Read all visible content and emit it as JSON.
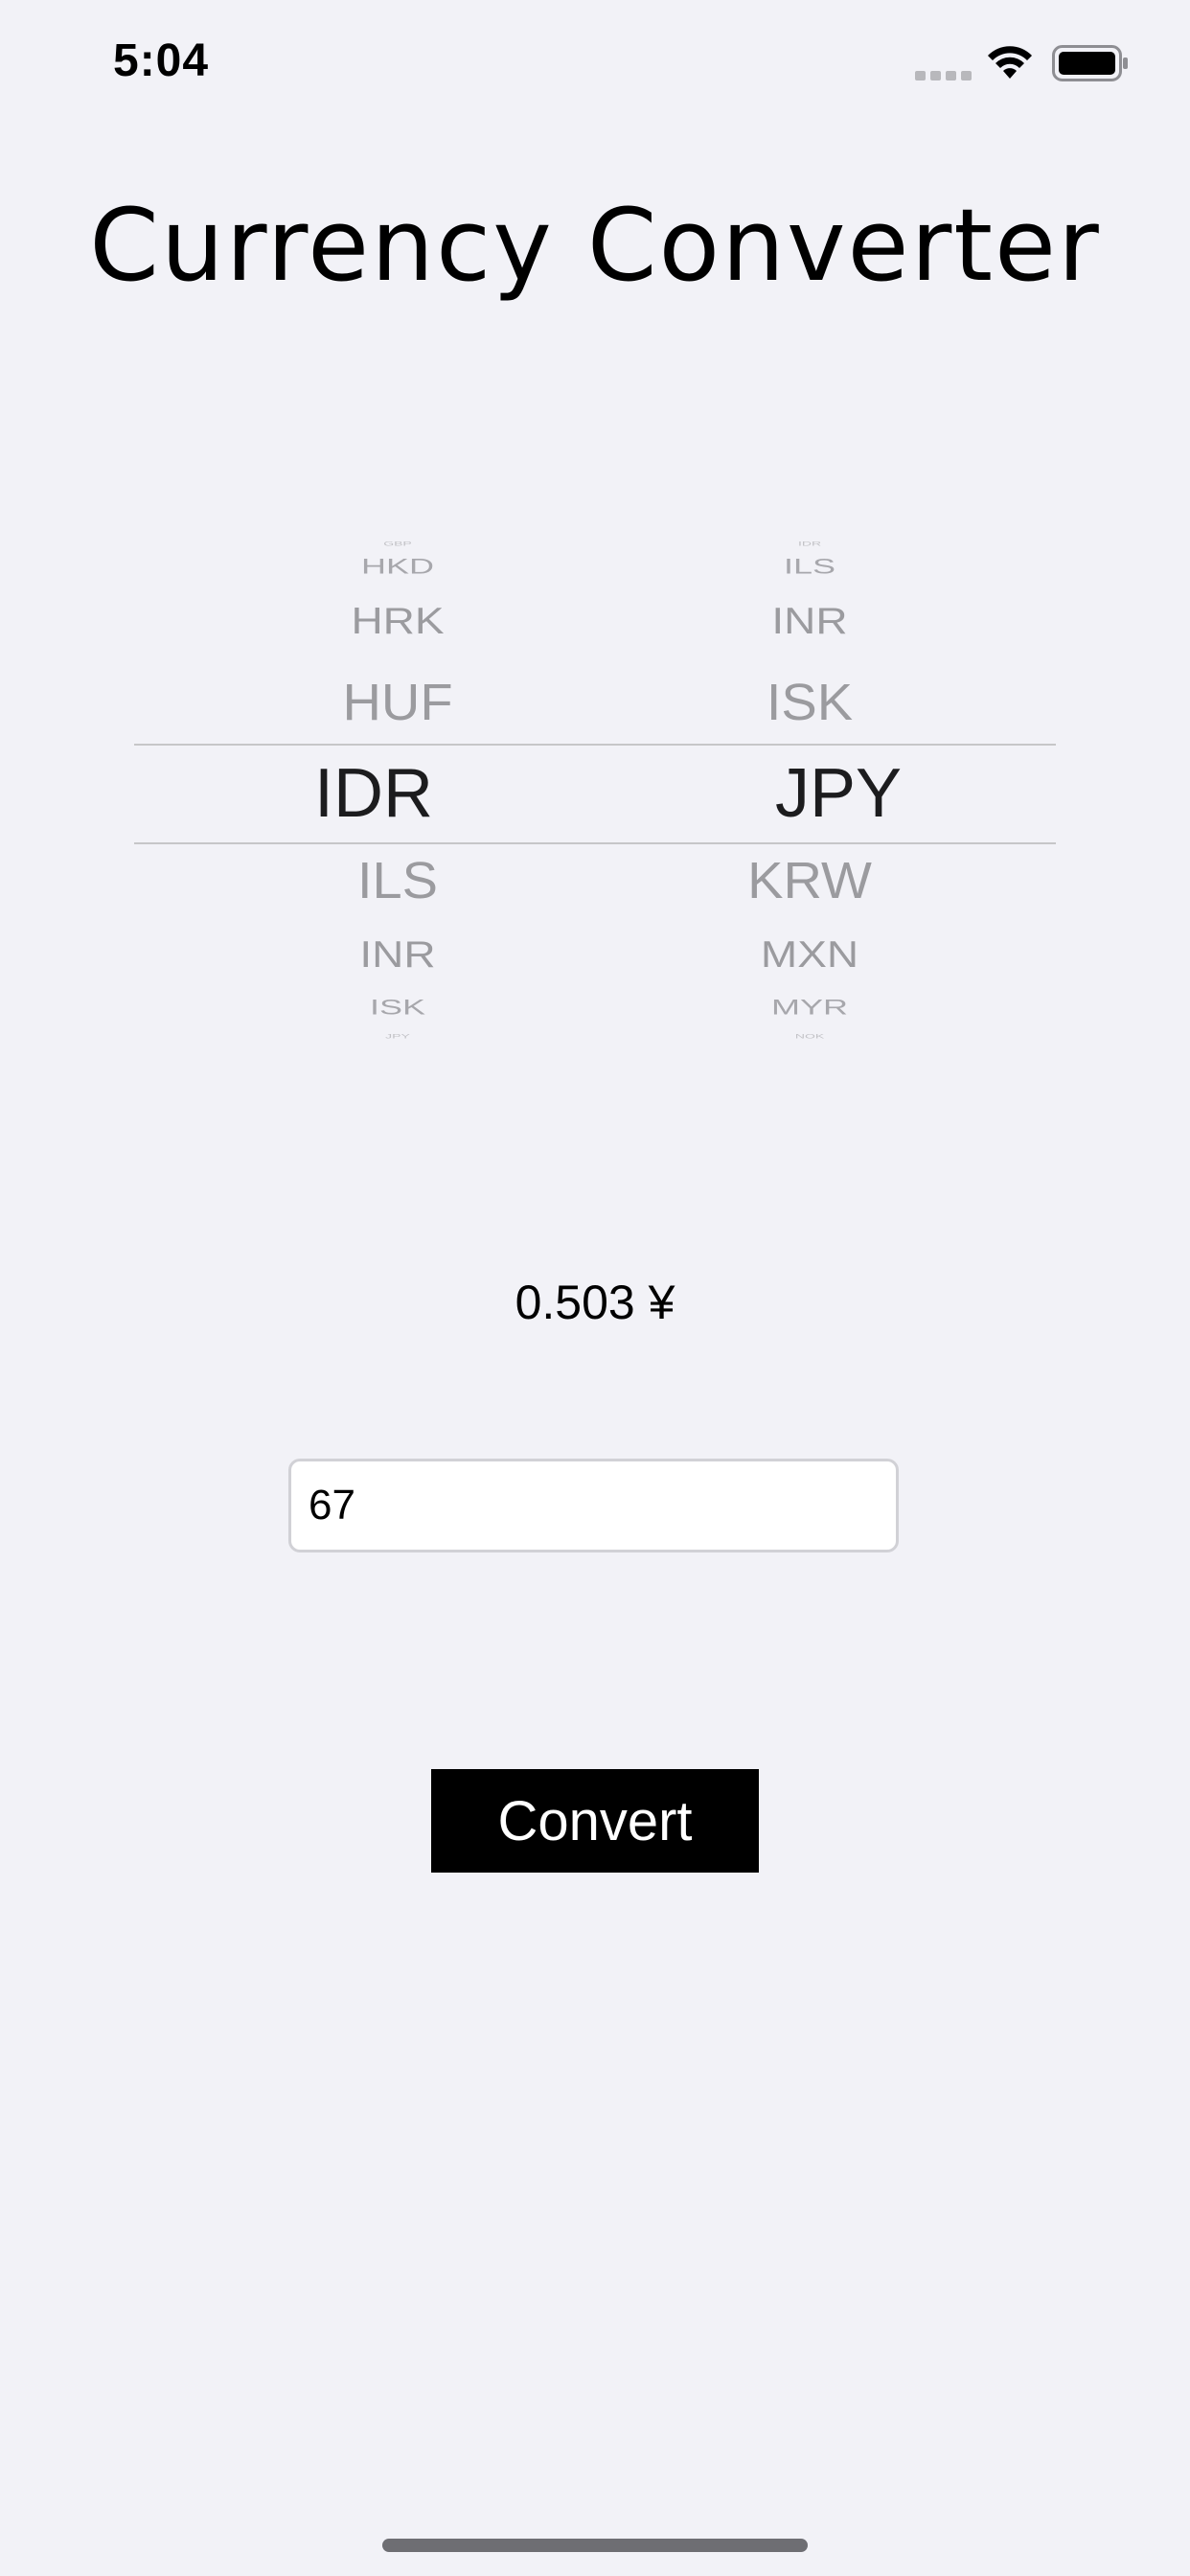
{
  "status_bar": {
    "time": "5:04",
    "icons": [
      "signal-icon",
      "wifi-icon",
      "battery-icon"
    ]
  },
  "title": "Currency Converter",
  "picker": {
    "from": {
      "items": [
        "GBP",
        "HKD",
        "HRK",
        "HUF",
        "IDR",
        "ILS",
        "INR",
        "ISK",
        "JPY"
      ],
      "selected": "IDR"
    },
    "to": {
      "items": [
        "IDR",
        "ILS",
        "INR",
        "ISK",
        "JPY",
        "KRW",
        "MXN",
        "MYR",
        "NOK"
      ],
      "selected": "JPY"
    }
  },
  "result": "0.503 ¥",
  "amount_input": {
    "value": "67"
  },
  "convert_button": {
    "label": "Convert"
  },
  "colors": {
    "background": "#f2f2f7",
    "button": "#000000",
    "picker_text": "#9b9b9f",
    "picker_selected": "#1c1c1e"
  }
}
